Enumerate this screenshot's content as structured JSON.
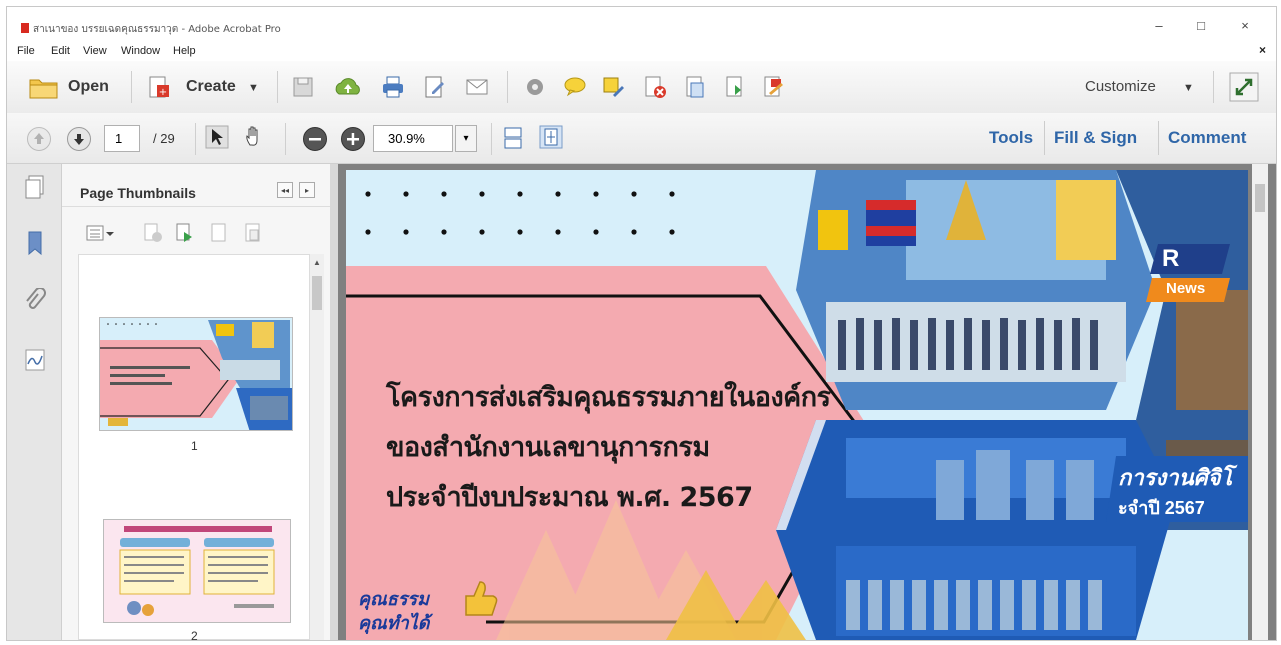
{
  "window": {
    "title": "สาเนาของ บรรยเฉดคุณธรรมาวุต - Adobe Acrobat Pro",
    "controls": [
      "–",
      "□",
      "×"
    ]
  },
  "menu": {
    "items": [
      "File",
      "Edit",
      "View",
      "Window",
      "Help"
    ],
    "close_glyph": "×"
  },
  "toolbar": {
    "open_label": "Open",
    "create_label": "Create",
    "customize_label": "Customize",
    "icons": [
      "folder-icon",
      "create-pdf-icon",
      "save-icon",
      "cloud-upload-icon",
      "print-icon",
      "edit-icon",
      "email-icon",
      "settings-icon",
      "comment-icon",
      "highlight-icon",
      "pdf-delete-icon",
      "pdf-page-icon",
      "pdf-extract-icon",
      "pdf-sign-icon",
      "expand-icon"
    ]
  },
  "navbar": {
    "current_page": "1",
    "total_pages": "/ 29",
    "zoom": "30.9%",
    "zoom_dropdown": "▾",
    "tools_label": "Tools",
    "fill_sign_label": "Fill & Sign",
    "comment_label": "Comment"
  },
  "thumbnails": {
    "title": "Page Thumbnails",
    "collapse_glyph": "◂◂",
    "expand_glyph": "▸",
    "pages": [
      {
        "label": "1"
      },
      {
        "label": "2"
      }
    ]
  },
  "document": {
    "title_lines": [
      "โครงการส่งเสริมคุณธรรมภายในองค์กร",
      "ของสำนักงานเลขานุการกรม",
      "ประจำปีงบประมาณ พ.ศ. 2567"
    ],
    "badge_line1": "คุณธรรม",
    "badge_line2": "คุณทำได้",
    "news_badge_r": "R",
    "news_badge": "News",
    "banner_text": "การงานศิจิโ",
    "banner_year": "ะจำปี 2567"
  },
  "colors": {
    "accent_link": "#2f66a8",
    "panel_pink": "#f4aab0",
    "sky": "#d7effa",
    "blue_hex": "#1f5bb5"
  }
}
